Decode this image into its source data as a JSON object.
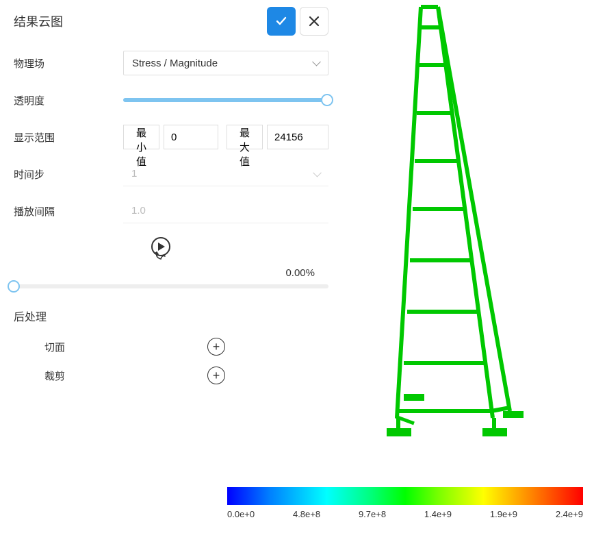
{
  "panel": {
    "title": "结果云图",
    "fields": {
      "physics_label": "物理场",
      "physics_value": "Stress / Magnitude",
      "opacity_label": "透明度",
      "range_label": "显示范围",
      "range_min_btn": "最小值",
      "range_min_val": "0",
      "range_max_btn": "最大值",
      "range_max_val": "24156",
      "timestep_label": "时间步",
      "timestep_value": "1",
      "interval_label": "播放间隔",
      "interval_value": "1.0",
      "progress": "0.00%"
    },
    "post": {
      "title": "后处理",
      "slice_label": "切面",
      "clip_label": "裁剪"
    }
  },
  "colorbar": {
    "ticks": [
      "0.0e+0",
      "4.8e+8",
      "9.7e+8",
      "1.4e+9",
      "1.9e+9",
      "2.4e+9"
    ]
  }
}
